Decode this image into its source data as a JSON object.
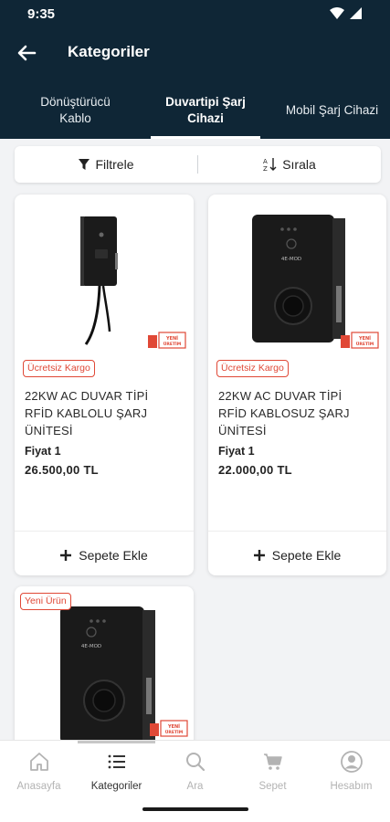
{
  "status_bar": {
    "time": "9:35"
  },
  "appbar": {
    "title": "Kategoriler"
  },
  "tabs": [
    {
      "label": "Dönüştürücü\nKablo",
      "active": false
    },
    {
      "label": "Duvartipi Şarj\nCihazi",
      "active": true
    },
    {
      "label": "Mobil Şarj Cihazi",
      "active": false
    }
  ],
  "toolbar": {
    "filter_label": "Filtrele",
    "sort_label": "Sırala"
  },
  "products": [
    {
      "badge": "Ücretsiz Kargo",
      "stamp": "YENİ ÜRETİM",
      "name": "22KW AC DUVAR TİPİ RFİD KABLOLU ŞARJ ÜNİTESİ",
      "price_label": "Fiyat 1",
      "price": "26.500,00 TL",
      "add_label": "Sepete Ekle"
    },
    {
      "badge": "Ücretsiz Kargo",
      "stamp": "YENİ ÜRETİM",
      "device_logo": "4E-MOD",
      "name": "22KW AC DUVAR TİPİ RFİD KABLOSUZ ŞARJ ÜNİTESİ",
      "price_label": "Fiyat 1",
      "price": "22.000,00 TL",
      "add_label": "Sepete Ekle"
    },
    {
      "badge": "Yeni Ürün",
      "stamp": "YENİ ÜRETİM",
      "device_logo": "4E-MOD"
    }
  ],
  "bottom_nav": [
    {
      "label": "Anasayfa",
      "icon": "home-icon",
      "active": false
    },
    {
      "label": "Kategoriler",
      "icon": "list-icon",
      "active": true
    },
    {
      "label": "Ara",
      "icon": "search-icon",
      "active": false
    },
    {
      "label": "Sepet",
      "icon": "cart-icon",
      "active": false
    },
    {
      "label": "Hesabım",
      "icon": "account-icon",
      "active": false
    }
  ],
  "colors": {
    "header_bg": "#0f2636",
    "badge_red": "#e04836",
    "page_bg": "#f2f3f5"
  }
}
